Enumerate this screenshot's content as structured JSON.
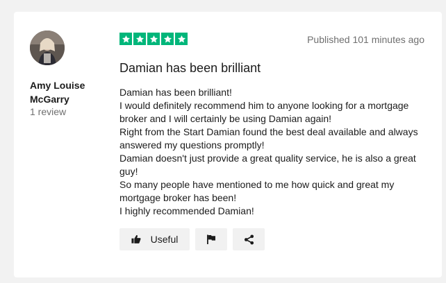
{
  "review": {
    "author": {
      "name": "Amy Louise McGarry",
      "review_count": "1 review"
    },
    "rating": {
      "stars": 5,
      "max": 5,
      "color": "#00b67a"
    },
    "published": "Published 101 minutes ago",
    "title": "Damian has been brilliant",
    "body_lines": [
      "Damian has been brilliant!",
      "I would definitely recommend him to anyone looking for a mortgage broker and I will certainly be using Damian again!",
      "Right from the Start Damian found the best deal available and always answered my questions promptly!",
      "Damian doesn't just provide a great quality service, he is also a great guy!",
      "So many people have mentioned to me how quick and great my mortgage broker has been!",
      "I highly recommended Damian!"
    ]
  },
  "actions": {
    "useful_label": "Useful",
    "useful_icon": "thumbs-up-icon",
    "flag_icon": "flag-icon",
    "share_icon": "share-icon"
  }
}
